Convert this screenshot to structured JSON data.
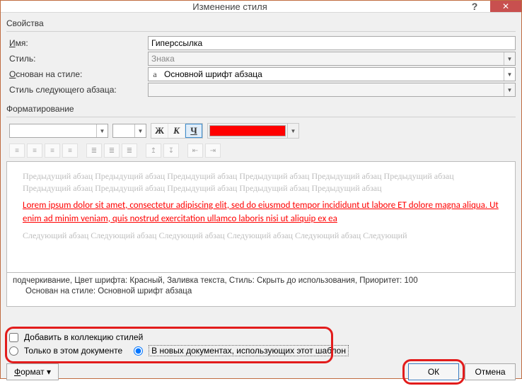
{
  "title": "Изменение стиля",
  "titlebar": {
    "help": "?",
    "close": "✕"
  },
  "sections": {
    "properties": "Свойства",
    "formatting": "Форматирование"
  },
  "props": {
    "name_label": "Имя:",
    "name_underline": "И",
    "name_rest": "мя:",
    "name_value": "Гиперссылка",
    "styletype_label": "Стиль:",
    "styletype_value": "Знака",
    "basedon_label_u": "О",
    "basedon_label_rest": "снован на стиле:",
    "basedon_value": "Основной шрифт абзаца",
    "nextstyle_label": "Стиль следующего абзаца:",
    "nextstyle_value": ""
  },
  "format": {
    "font_value": "",
    "size_value": "",
    "bold": "Ж",
    "italic": "К",
    "underline": "Ч",
    "color": "#ff0000"
  },
  "preview": {
    "prev_text": "Предыдущий абзац Предыдущий абзац Предыдущий абзац Предыдущий абзац Предыдущий абзац Предыдущий абзац Предыдущий абзац Предыдущий абзац Предыдущий абзац Предыдущий абзац Предыдущий абзац",
    "sample": "Lorem ipsum dolor sit amet, consectetur adipiscing elit, sed do eiusmod tempor incididunt ut labore ET dolore magna aliqua. Ut enim ad minim veniam, quis nostrud exercitation ullamco laboris nisi ut aliquip ex ea",
    "next_text": "Следующий абзац Следующий абзац Следующий абзац Следующий абзац Следующий абзац Следующий"
  },
  "description": {
    "line1": "подчеркивание, Цвет шрифта: Красный, Заливка текста, Стиль: Скрыть до использования, Приоритет: 100",
    "line2": "Основан на стиле: Основной шрифт абзаца"
  },
  "options": {
    "add_collection_u": "Д",
    "add_collection_rest": "обавить в коллекцию стилей",
    "only_doc": "Только в этом документе",
    "new_docs": "В новых документах, использующих этот шаблон"
  },
  "buttons": {
    "format_u": "Ф",
    "format_rest": "ормат ▾",
    "ok": "ОК",
    "cancel": "Отмена"
  }
}
